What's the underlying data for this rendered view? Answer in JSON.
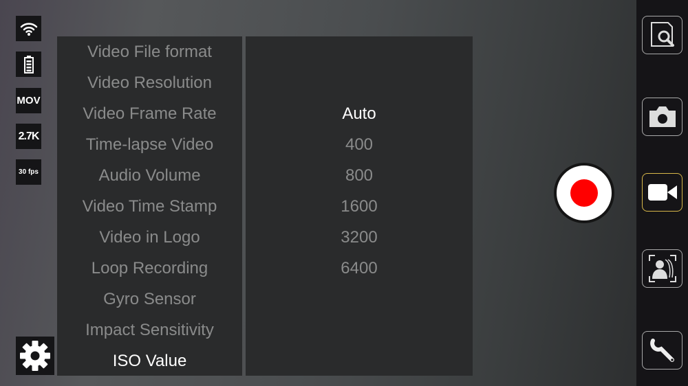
{
  "status": {
    "wifi": "wifi-icon",
    "battery": "battery-icon",
    "format": "MOV",
    "resolution": "2.7K",
    "fps": "30 fps"
  },
  "menu": {
    "items": [
      "Video File format",
      "Video Resolution",
      "Video Frame Rate",
      "Time-lapse Video",
      "Audio Volume",
      "Video Time Stamp",
      "Video in Logo",
      "Loop Recording",
      "Gyro Sensor",
      "Impact Sensitivity",
      "ISO Value"
    ],
    "selected_index": 10
  },
  "options": {
    "items": [
      "Auto",
      "400",
      "800",
      "1600",
      "3200",
      "6400"
    ],
    "selected_index": 0
  },
  "record": {
    "color": "#ff0000"
  },
  "sidebar": {
    "items": [
      "file-browser-icon",
      "camera-icon",
      "video-camera-icon",
      "burst-photo-icon",
      "wrench-icon"
    ],
    "active_index": 2,
    "accent": "#d9b94a"
  }
}
